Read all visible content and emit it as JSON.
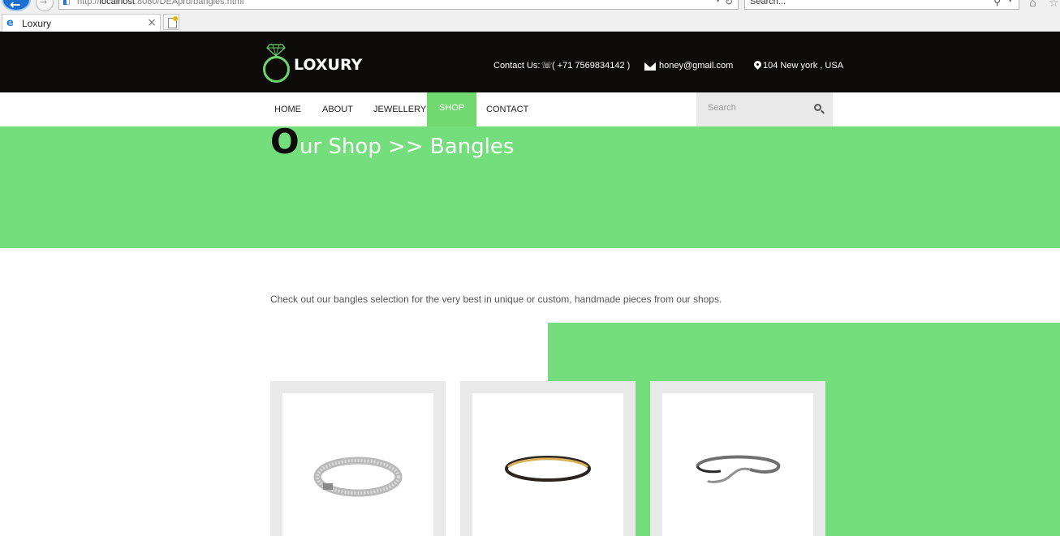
{
  "browser": {
    "url_prefix": "http://",
    "url_host": "localhost",
    "url_rest": ":8080/DEApro/bangles.html",
    "search_placeholder": "Search...",
    "tab_title": "Loxury",
    "tab_close": "×"
  },
  "header": {
    "logo_text": "LOXURY",
    "contact_label": "Contact Us:",
    "phone": "( +71 7569834142 )",
    "email": "honey@gmail.com",
    "location": "104 New york , USA"
  },
  "nav": {
    "items": [
      {
        "label": "HOME"
      },
      {
        "label": "ABOUT"
      },
      {
        "label": "JEWELLERY"
      },
      {
        "label": "SHOP",
        "active": true
      },
      {
        "label": "CONTACT"
      }
    ],
    "search_placeholder": "Search"
  },
  "banner": {
    "first_letter": "O",
    "title_rest": "ur Shop >> Bangles"
  },
  "content": {
    "intro": "Check out our bangles selection for the very best in unique or custom, handmade pieces from our shops."
  },
  "products": [
    {
      "icon": "silver-bangle"
    },
    {
      "icon": "gold-bangle"
    },
    {
      "icon": "twisted-bangle"
    }
  ],
  "colors": {
    "accent_green": "#73de7b",
    "header_black": "#0d0a0a"
  }
}
